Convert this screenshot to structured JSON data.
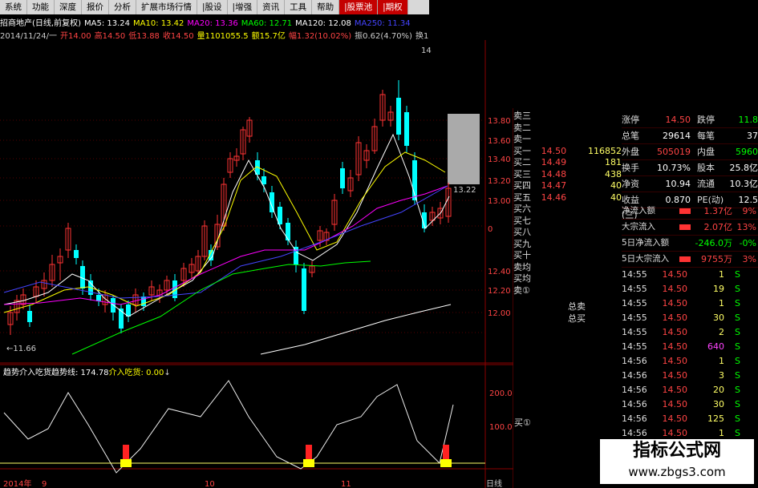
{
  "menu": [
    "系统",
    "功能",
    "深度",
    "报价",
    "分析",
    "扩展市场行情",
    "|股设",
    "|增强",
    "资讯",
    "工具",
    "帮助",
    "|股票池",
    "|期权"
  ],
  "info1": [
    {
      "t": "招商地产(日线,前复权)",
      "c": "#ffffff"
    },
    {
      "t": "MA5: 13.24",
      "c": "#ffffff"
    },
    {
      "t": "MA10: 13.42",
      "c": "#ffff00"
    },
    {
      "t": "MA20: 13.36",
      "c": "#ff00ff"
    },
    {
      "t": "MA60: 12.71",
      "c": "#00ff00"
    },
    {
      "t": "MA120: 12.08",
      "c": "#ffffff"
    },
    {
      "t": "MA250: 11.34",
      "c": "#4444ff"
    }
  ],
  "info2": [
    {
      "t": "2014/11/24/一",
      "c": "#ccc"
    },
    {
      "t": "开14.00",
      "c": "#ff4444"
    },
    {
      "t": "高14.50",
      "c": "#ff4444"
    },
    {
      "t": "低13.88",
      "c": "#ff4444"
    },
    {
      "t": "收14.50",
      "c": "#ff4444"
    },
    {
      "t": "量1101055.5",
      "c": "#ffff00"
    },
    {
      "t": "额15.7亿",
      "c": "#ffff00"
    },
    {
      "t": "幅1.32(10.02%)",
      "c": "#ff4444"
    },
    {
      "t": "振0.62(4.70%)",
      "c": "#ccc"
    },
    {
      "t": "换10.73%",
      "c": "#ccc"
    },
    {
      "t": "流通10.3亿",
      "c": "#ccc"
    },
    {
      "t": "全图",
      "c": "#00ff00"
    }
  ],
  "panel": [
    {
      "t": "趋势介入吃货",
      "c": "#ffffff"
    },
    {
      "t": "趋势线: 174.78",
      "c": "#ffffff"
    },
    {
      "t": "介入吃货: 0.00",
      "c": "#ffff00"
    },
    {
      "t": "↓",
      "c": "#ccc"
    }
  ],
  "axis_labels": {
    "price_ticks": [
      "13.80",
      "13.60",
      "13.40",
      "13.20",
      "13.00",
      "0",
      "12.40",
      "12.20",
      "12.00"
    ],
    "osc_ticks": [
      "200.0",
      "100.0"
    ],
    "cursor_price": "13.22",
    "low_mark": "←11.66",
    "top_mark": "14",
    "x_ticks": [
      "2014年",
      "9",
      "10",
      "11"
    ],
    "period": "日线"
  },
  "orderbook": [
    {
      "label": "卖三",
      "price": "",
      "vol": ""
    },
    {
      "label": "卖二",
      "price": "",
      "vol": ""
    },
    {
      "label": "卖一",
      "price": "",
      "vol": ""
    },
    {
      "label": "买一",
      "price": "14.50",
      "vol": "116852"
    },
    {
      "label": "买二",
      "price": "14.49",
      "vol": "181"
    },
    {
      "label": "买三",
      "price": "14.48",
      "vol": "438"
    },
    {
      "label": "买四",
      "price": "14.47",
      "vol": "40"
    },
    {
      "label": "买五",
      "price": "14.46",
      "vol": "40"
    },
    {
      "label": "买六",
      "price": "",
      "vol": ""
    },
    {
      "label": "买七",
      "price": "",
      "vol": ""
    },
    {
      "label": "买八",
      "price": "",
      "vol": ""
    },
    {
      "label": "买九",
      "price": "",
      "vol": ""
    },
    {
      "label": "买十",
      "price": "",
      "vol": ""
    },
    {
      "label": "卖均",
      "price": "",
      "vol": ""
    },
    {
      "label": "买均",
      "price": "",
      "vol": ""
    },
    {
      "label": "卖①",
      "price": "",
      "vol": ""
    }
  ],
  "orderbook_extra": {
    "sell_total": "总卖",
    "buy_total": "总买",
    "buy_one": "买①"
  },
  "stats": [
    {
      "k": "涨停",
      "v": "14.50",
      "vc": "#ff4444",
      "k2": "跌停",
      "v2": "11.8",
      "v2c": "#00ff00"
    },
    {
      "k": "总笔",
      "v": "29614",
      "vc": "#ffffff",
      "k2": "每笔",
      "v2": "37",
      "v2c": "#ffffff"
    },
    {
      "k": "外盘",
      "v": "505019",
      "vc": "#ff4444",
      "k2": "内盘",
      "v2": "5960",
      "v2c": "#00ff00"
    },
    {
      "k": "换手",
      "v": "10.73%",
      "vc": "#ffffff",
      "k2": "股本",
      "v2": "25.8亿",
      "v2c": "#ffffff"
    },
    {
      "k": "净资",
      "v": "10.94",
      "vc": "#ffffff",
      "k2": "流通",
      "v2": "10.3亿",
      "v2c": "#ffffff"
    },
    {
      "k": "收益(三)",
      "v": "0.870",
      "vc": "#ffffff",
      "k2": "PE(动)",
      "v2": "12.5",
      "v2c": "#ffffff"
    }
  ],
  "flows": [
    {
      "k": "净流入额",
      "v": "1.37亿",
      "p": "9%",
      "vc": "#ff4444",
      "bar": "#ff3333"
    },
    {
      "k": "大宗流入",
      "v": "2.07亿",
      "p": "13%",
      "vc": "#ff4444",
      "bar": "#ff3333"
    },
    {
      "k": "5日净流入额",
      "v": "-246.0万",
      "p": "-0%",
      "vc": "#00ff00",
      "bar": ""
    },
    {
      "k": "5日大宗流入",
      "v": "9755万",
      "p": "3%",
      "vc": "#ff4444",
      "bar": "#ff3333"
    }
  ],
  "ticks": [
    {
      "t": "14:55",
      "p": "14.50",
      "v": "1",
      "s": "S",
      "vc": "#ffff66"
    },
    {
      "t": "14:55",
      "p": "14.50",
      "v": "19",
      "s": "S",
      "vc": "#ffff66"
    },
    {
      "t": "14:55",
      "p": "14.50",
      "v": "1",
      "s": "S",
      "vc": "#ffff66"
    },
    {
      "t": "14:55",
      "p": "14.50",
      "v": "30",
      "s": "S",
      "vc": "#ffff66"
    },
    {
      "t": "14:55",
      "p": "14.50",
      "v": "2",
      "s": "S",
      "vc": "#ffff66"
    },
    {
      "t": "14:55",
      "p": "14.50",
      "v": "640",
      "s": "S",
      "vc": "#ff44ff"
    },
    {
      "t": "14:56",
      "p": "14.50",
      "v": "1",
      "s": "S",
      "vc": "#ffff66"
    },
    {
      "t": "14:56",
      "p": "14.50",
      "v": "3",
      "s": "S",
      "vc": "#ffff66"
    },
    {
      "t": "14:56",
      "p": "14.50",
      "v": "20",
      "s": "S",
      "vc": "#ffff66"
    },
    {
      "t": "14:56",
      "p": "14.50",
      "v": "30",
      "s": "S",
      "vc": "#ffff66"
    },
    {
      "t": "14:56",
      "p": "14.50",
      "v": "125",
      "s": "S",
      "vc": "#ffff66"
    },
    {
      "t": "14:56",
      "p": "14.50",
      "v": "1",
      "s": "S",
      "vc": "#ffff66"
    }
  ],
  "watermark": {
    "title": "指标公式网",
    "url": "www.zbgs3.com"
  },
  "colors": {
    "up": "#ff3333",
    "down": "#00ffff",
    "grid": "#8b0000"
  }
}
